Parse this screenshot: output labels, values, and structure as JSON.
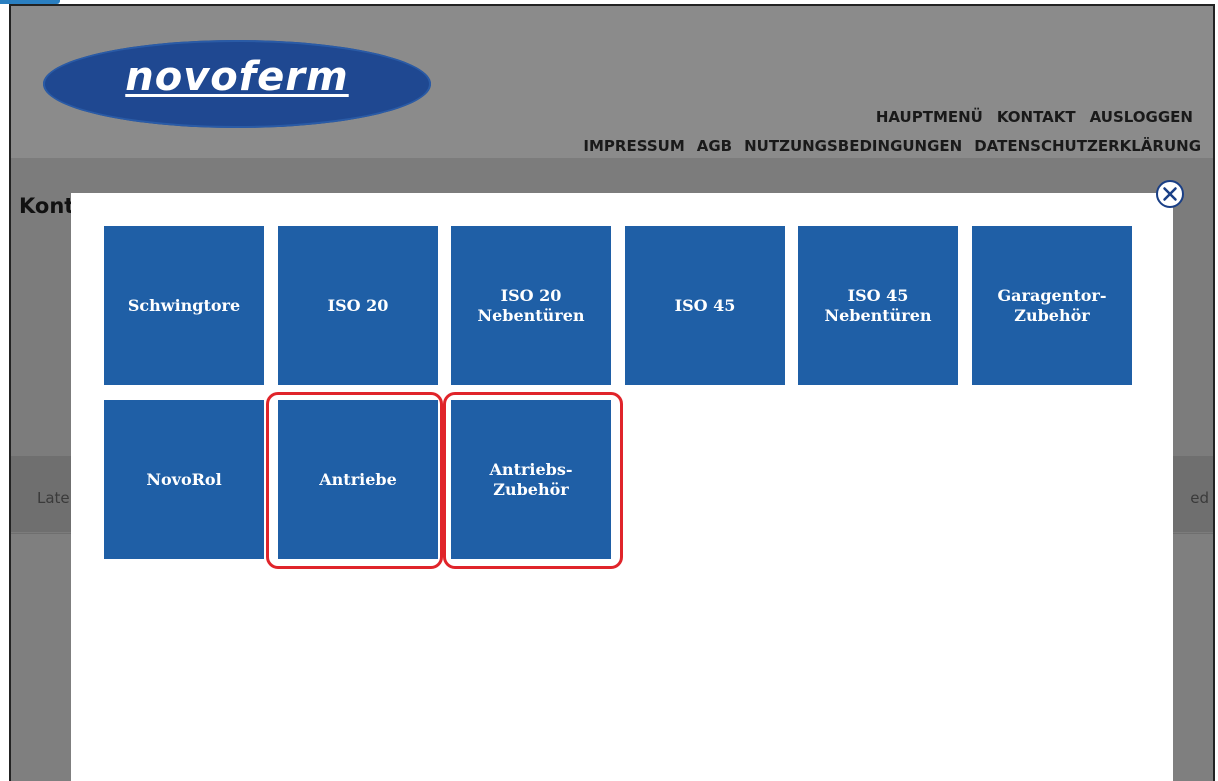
{
  "header": {
    "logo_text": "novoferm",
    "nav_primary": [
      "HAUPTMENÜ",
      "KONTAKT",
      "AUSLOGGEN"
    ],
    "nav_secondary": [
      "IMPRESSUM",
      "AGB",
      "NUTZUNGSBEDINGUNGEN",
      "DATENSCHUTZERKLÄRUNG"
    ]
  },
  "background": {
    "title_partial": "Kont",
    "left_text_partial": "Late",
    "right_text_partial": "ed"
  },
  "modal": {
    "close_icon": "close-circle-icon",
    "tiles": [
      {
        "label": "Schwingtore",
        "highlighted": false
      },
      {
        "label": "ISO 20",
        "highlighted": false
      },
      {
        "label": "ISO 20\nNebentüren",
        "highlighted": false
      },
      {
        "label": "ISO 45",
        "highlighted": false
      },
      {
        "label": "ISO 45\nNebentüren",
        "highlighted": false
      },
      {
        "label": "Garagentor-\nZubehör",
        "highlighted": false
      },
      {
        "label": "NovoRol",
        "highlighted": false
      },
      {
        "label": "Antriebe",
        "highlighted": true
      },
      {
        "label": "Antriebs-\nZubehör",
        "highlighted": true
      }
    ]
  },
  "colors": {
    "tile_blue": "#1f5fa6",
    "logo_blue": "#1f4891",
    "highlight_red": "#e0242a",
    "overlay_gray": "#7f7f7f"
  }
}
